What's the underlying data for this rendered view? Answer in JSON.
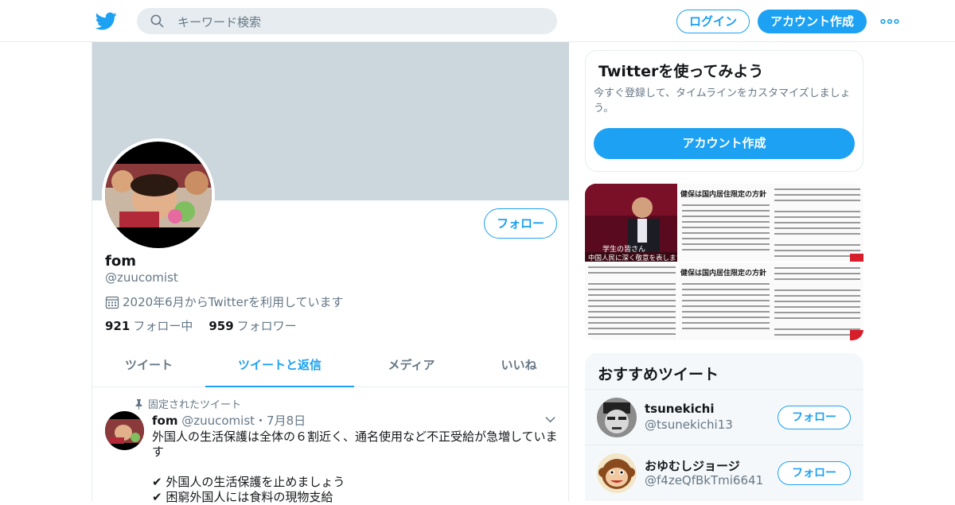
{
  "header": {
    "search_placeholder": "キーワード検索",
    "login_label": "ログイン",
    "create_account_label": "アカウント作成"
  },
  "profile": {
    "name": "fom",
    "handle": "@zuucomist",
    "joined": "2020年6月からTwitterを利用しています",
    "following_count": "921",
    "following_label": "フォロー中",
    "followers_count": "959",
    "followers_label": "フォロワー",
    "follow_label": "フォロー"
  },
  "tabs": [
    {
      "label": "ツイート"
    },
    {
      "label": "ツイートと返信"
    },
    {
      "label": "メディア"
    },
    {
      "label": "いいね"
    }
  ],
  "tweet": {
    "pinned_label": "固定されたツイート",
    "author_name": "fom",
    "author_handle": "@zuucomist",
    "date": "・7月8日",
    "lines": [
      "外国人の生活保護は全体の６割近く、通名使用など不正受給が急増していま",
      "す",
      "",
      "✔ 外国人の生活保護を止めましょう",
      "✔ 困窮外国人には食料の現物支給"
    ]
  },
  "signup_card": {
    "title": "Twitterを使ってみよう",
    "description": "今すぐ登録して、タイムラインをカスタマイズしましょう。",
    "button_label": "アカウント作成"
  },
  "media": {
    "caption_line1": "学生の皆さん",
    "caption_line2": "中国人民に深く敬意を表します",
    "headline": "健保は国内居住限定の方針"
  },
  "recommendations": {
    "title": "おすすめツイート",
    "follow_label": "フォロー",
    "items": [
      {
        "name": "tsunekichi",
        "handle": "@tsunekichi13"
      },
      {
        "name": "おゆむしジョージ",
        "handle": "@f4zeQfBkTmi6641"
      }
    ]
  },
  "colors": {
    "accent": "#1da1f2",
    "secondary_text": "#657786",
    "border": "#e6ecf0",
    "banner": "#ccd6dd"
  }
}
